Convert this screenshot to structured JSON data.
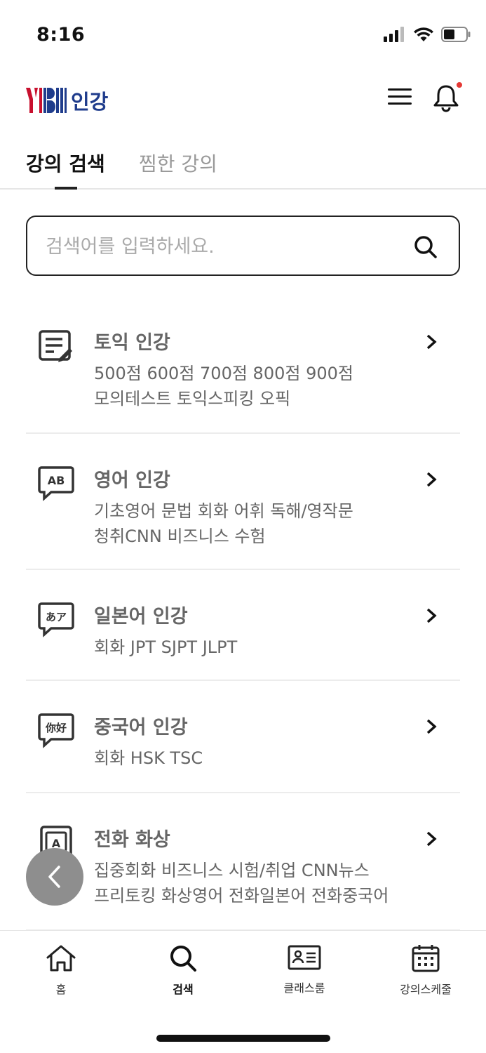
{
  "status_bar": {
    "time": "8:16"
  },
  "header": {
    "logo_mark": "YBM",
    "logo_text": "인강",
    "notification_dot_color": "#e53935"
  },
  "tabs": [
    {
      "label": "강의 검색",
      "active": true
    },
    {
      "label": "찜한 강의",
      "active": false
    }
  ],
  "search": {
    "placeholder": "검색어를 입력하세요.",
    "value": ""
  },
  "categories": [
    {
      "title": "토익 인강",
      "icon": "document-edit-icon",
      "tags_line1": "500점 600점 700점 800점 900점",
      "tags_line2": "모의테스트 토익스피킹 오픽"
    },
    {
      "title": "영어 인강",
      "icon": "ab-speech-icon",
      "badge": "AB",
      "tags_line1": "기초영어 문법 회화 어휘 독해/영작문",
      "tags_line2": "청취CNN 비즈니스 수험"
    },
    {
      "title": "일본어 인강",
      "icon": "japanese-speech-icon",
      "badge": "あア",
      "tags_line1": "회화 JPT SJPT JLPT",
      "tags_line2": ""
    },
    {
      "title": "중국어 인강",
      "icon": "chinese-speech-icon",
      "badge": "你好",
      "tags_line1": "회화 HSK TSC",
      "tags_line2": ""
    },
    {
      "title": "전화 화상",
      "icon": "video-call-icon",
      "badge": "A",
      "tags_line1": "집중회화 비즈니스 시험/취업 CNN뉴스",
      "tags_line2": "프리토킹 화상영어 전화일본어 전화중국어"
    }
  ],
  "bottom_nav": [
    {
      "label": "홈",
      "icon": "home-icon",
      "active": false
    },
    {
      "label": "검색",
      "icon": "search-icon",
      "active": true
    },
    {
      "label": "클래스룸",
      "icon": "id-card-icon",
      "active": false
    },
    {
      "label": "강의스케줄",
      "icon": "calendar-icon",
      "active": false
    }
  ],
  "colors": {
    "brand_blue": "#1f3c8c",
    "brand_red": "#c8102e",
    "text_gray": "#666666"
  }
}
